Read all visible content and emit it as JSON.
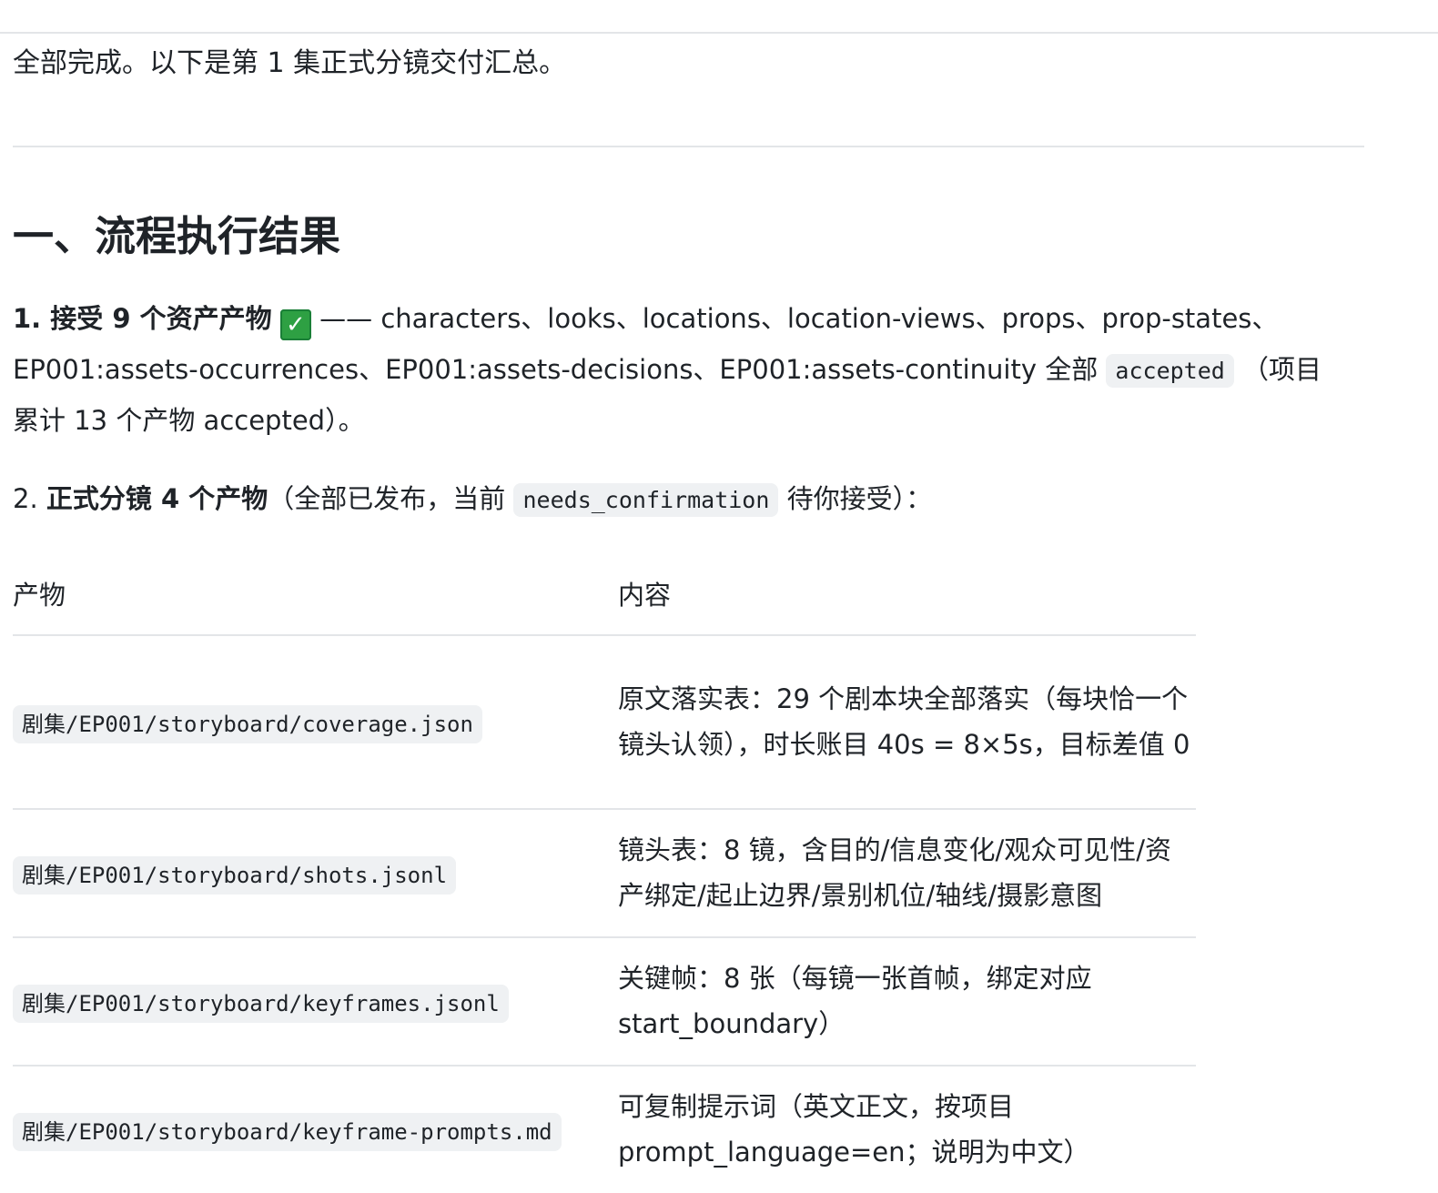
{
  "intro": "全部完成。以下是第 1 集正式分镜交付汇总。",
  "section_title": "一、流程执行结果",
  "item1": {
    "label": "1. 接受 9 个资产产物",
    "check_icon": "white-check-mark-emoji",
    "text_before_code": " —— characters、looks、locations、location-views、props、prop-states、EP001:assets-occurrences、EP001:assets-decisions、EP001:assets-continuity 全部 ",
    "code": "accepted",
    "text_after_code": " （项目累计 13 个产物 accepted）。"
  },
  "item2": {
    "number": "2. ",
    "label": "正式分镜 4 个产物",
    "text_before_code": "（全部已发布，当前 ",
    "code": "needs_confirmation",
    "text_after_code": " 待你接受）："
  },
  "table": {
    "headers": [
      "产物",
      "内容"
    ],
    "rows": [
      {
        "path": "剧集/EP001/storyboard/coverage.json",
        "content": "原文落实表：29 个剧本块全部落实（每块恰一个镜头认领），时长账目 40s = 8×5s，目标差值 0"
      },
      {
        "path": "剧集/EP001/storyboard/shots.jsonl",
        "content": "镜头表：8 镜，含目的/信息变化/观众可见性/资产绑定/起止边界/景别机位/轴线/摄影意图"
      },
      {
        "path": "剧集/EP001/storyboard/keyframes.jsonl",
        "content": "关键帧：8 张（每镜一张首帧，绑定对应 start_boundary）"
      },
      {
        "path": "剧集/EP001/storyboard/keyframe-prompts.md",
        "content": "可复制提示词（英文正文，按项目 prompt_language=en；说明为中文）"
      }
    ]
  },
  "colors": {
    "text": "#1f2328",
    "rule": "#e3e5e8",
    "code_bg": "#eff1f3",
    "check_green": "#2ea043"
  }
}
